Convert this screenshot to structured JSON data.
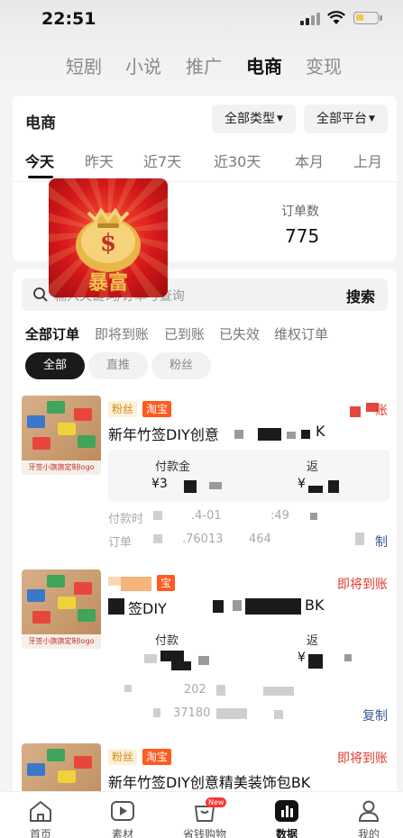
{
  "status_bar": {
    "time": "22:51"
  },
  "top_tabs": [
    {
      "label": "短剧",
      "active": false
    },
    {
      "label": "小说",
      "active": false
    },
    {
      "label": "推广",
      "active": false
    },
    {
      "label": "电商",
      "active": true
    },
    {
      "label": "变现",
      "active": false
    }
  ],
  "summary": {
    "title": "电商",
    "filter_type": "全部类型",
    "filter_platform": "全部平台",
    "periods": [
      "今天",
      "昨天",
      "近7天",
      "近30天",
      "本月",
      "上月"
    ],
    "active_period": "今天",
    "order_count_label": "订单数",
    "order_count_value": "775"
  },
  "logo": {
    "text": "暴富"
  },
  "orders_panel": {
    "search_placeholder": "输入关键词/订单号查询",
    "search_button": "搜索",
    "order_tabs": [
      "全部订单",
      "即将到账",
      "已到账",
      "已失效",
      "维权订单"
    ],
    "filter_pills": [
      "全部",
      "直推",
      "粉丝"
    ]
  },
  "orders": [
    {
      "tag_fans": "粉丝",
      "tag_platform": "淘宝",
      "status": "账",
      "name": "新年竹签DIY创意",
      "name_tail": "K",
      "pay_amount_label": "付款金",
      "rebate_label": "返",
      "pay_amount": "¥3",
      "rebate": "¥",
      "pay_time_label": "付款时",
      "pay_time": ".4-01",
      "pay_time_tail": ":49",
      "order_label": "订单",
      "order_no": ".76013",
      "order_no_tail": "464",
      "copy": "制",
      "thumb_caption": "牙签小旗旗定制logo"
    },
    {
      "tag_fans": "",
      "tag_platform": "宝",
      "status": "即将到账",
      "name": "签DIY",
      "name_tail": "BK",
      "pay_amount_label": "付款",
      "rebate_label": "返",
      "pay_amount": "",
      "rebate": "¥",
      "pay_time_label": "",
      "pay_time": "202",
      "pay_time_tail": "",
      "order_label": "",
      "order_no": "37180",
      "order_no_tail": "",
      "copy": "复制",
      "thumb_caption": "牙签小旗旗定制logo"
    },
    {
      "tag_fans": "粉丝",
      "tag_platform": "淘宝",
      "status": "即将到账",
      "name": "新年竹签DIY创意精美装饰包BK",
      "thumb_caption": ""
    }
  ],
  "bottom_nav": [
    {
      "label": "首页",
      "icon": "home-icon",
      "active": false
    },
    {
      "label": "素材",
      "icon": "play-icon",
      "active": false
    },
    {
      "label": "省钱购物",
      "icon": "shopping-bag-icon",
      "active": false,
      "badge": "New"
    },
    {
      "label": "数据",
      "icon": "bar-chart-icon",
      "active": true
    },
    {
      "label": "我的",
      "icon": "user-icon",
      "active": false
    }
  ],
  "colors": {
    "accent_red": "#e33b2e",
    "taobao_orange": "#ff5a1f",
    "link_blue": "#3b5b9a"
  }
}
